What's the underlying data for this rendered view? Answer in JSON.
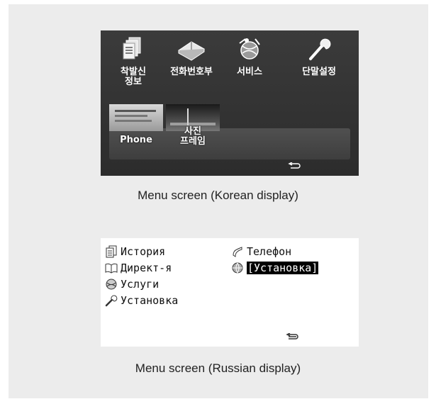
{
  "korean_screen": {
    "caption": "Menu screen (Korean display)",
    "menu_items": [
      {
        "label": "착발신\n정보",
        "icon": "call-history-icon"
      },
      {
        "label": "전화번호부",
        "icon": "phonebook-icon"
      },
      {
        "label": "서비스",
        "icon": "services-icon"
      },
      {
        "label": "단말설정",
        "icon": "settings-wrench-icon"
      }
    ],
    "dock_items": [
      {
        "label": "Phone",
        "icon": "phone-thumbnail"
      },
      {
        "label": "사진\n프레임",
        "icon": "photo-frame-thumbnail"
      }
    ],
    "back_icon": "back-arrow-icon"
  },
  "russian_screen": {
    "caption": "Menu screen (Russian display)",
    "menu_items": [
      {
        "label": "История",
        "icon": "history-icon",
        "selected": false
      },
      {
        "label": "Директ-я",
        "icon": "directory-book-icon",
        "selected": false
      },
      {
        "label": "Услуги",
        "icon": "services-icon",
        "selected": false
      },
      {
        "label": "Установка",
        "icon": "wrench-icon",
        "selected": false
      },
      {
        "label": "Телефон",
        "icon": "phone-handset-icon",
        "selected": false
      },
      {
        "label": "[Установка]",
        "icon": "globe-settings-icon",
        "selected": true
      }
    ],
    "back_icon": "back-arrow-icon"
  }
}
